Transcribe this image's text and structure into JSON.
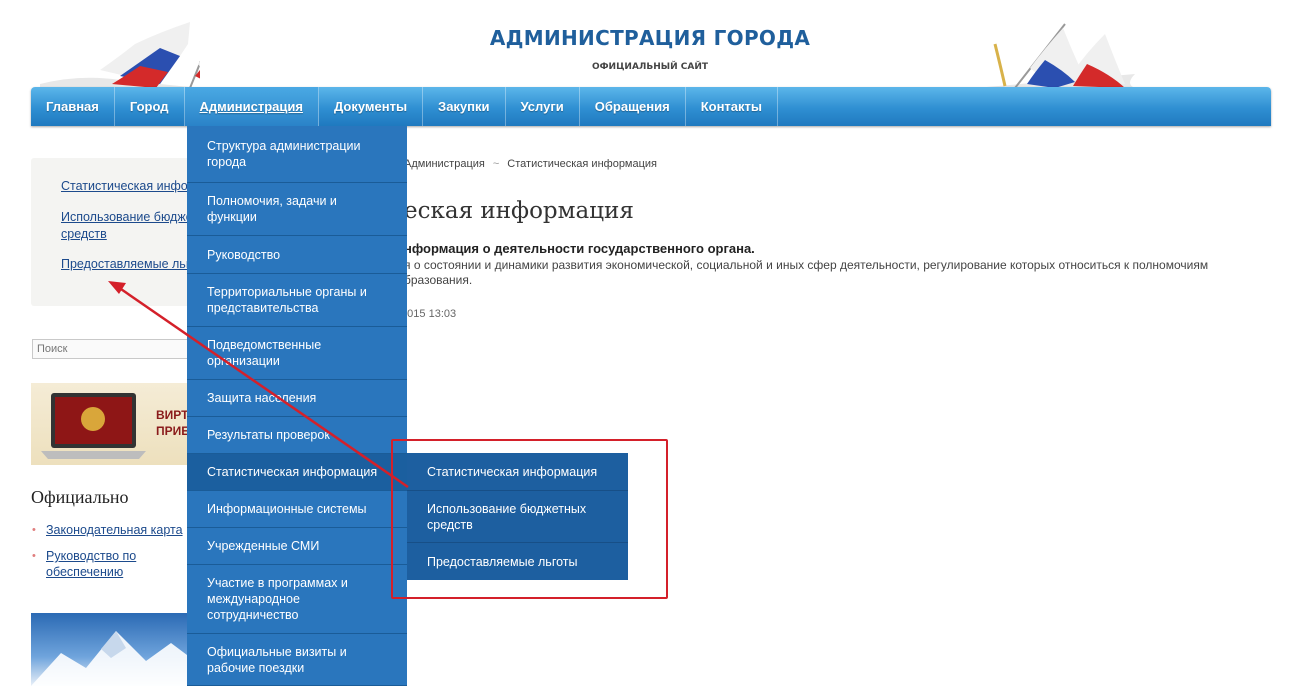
{
  "header": {
    "title": "АДМИНИСТРАЦИЯ ГОРОДА",
    "subtitle": "ОФИЦИАЛЬНЫЙ САЙТ"
  },
  "nav": {
    "items": [
      {
        "label": "Главная"
      },
      {
        "label": "Город"
      },
      {
        "label": "Администрация"
      },
      {
        "label": "Документы"
      },
      {
        "label": "Закупки"
      },
      {
        "label": "Услуги"
      },
      {
        "label": "Обращения"
      },
      {
        "label": "Контакты"
      }
    ]
  },
  "sidebar": {
    "links": [
      {
        "label": "Статистическая информация"
      },
      {
        "label": "Использование бюджетных"
      },
      {
        "label": "средств"
      },
      {
        "label": "Предоставляемые льготы"
      }
    ],
    "search_placeholder": "Поиск",
    "banner_line1": "ВИРТ",
    "banner_line2": "ПРИЕ",
    "official_title": "Официально",
    "official_links": [
      {
        "label": "Законодательная карта"
      },
      {
        "label": "Руководство по обеспечению доступности веб-контента"
      }
    ]
  },
  "main": {
    "breadcrumb_current_parent": "Администрация",
    "breadcrumb_sep": "~",
    "breadcrumb_current": "Статистическая информация",
    "title": "еская информация",
    "subheading": "нформация о деятельности государственного органа.",
    "description": "я о состоянии и динамики развития экономической, социальной и иных сфер деятельности, регулирование которых относиться к полномочиям",
    "description2": "бразования.",
    "date": ".2015 13:03"
  },
  "dropdown": {
    "items": [
      {
        "label": "Структура администрации города"
      },
      {
        "label": "Полномочия, задачи и функции"
      },
      {
        "label": "Руководство"
      },
      {
        "label": "Территориальные органы и представительства"
      },
      {
        "label": "Подведомственные организации"
      },
      {
        "label": "Защита населения"
      },
      {
        "label": "Результаты проверок"
      },
      {
        "label": "Статистическая информация"
      },
      {
        "label": "Информационные системы"
      },
      {
        "label": "Учрежденные СМИ"
      },
      {
        "label": "Участие в программах и международное сотрудничество"
      },
      {
        "label": "Официальные визиты и рабочие поездки"
      }
    ]
  },
  "submenu": {
    "items": [
      {
        "label": "Статистическая информация"
      },
      {
        "label": "Использование бюджетных средств"
      },
      {
        "label": "Предоставляемые льготы"
      }
    ]
  },
  "colors": {
    "nav_blue": "#2f8fd2",
    "dropdown_blue": "#2a76bd",
    "submenu_blue": "#1d5fa0",
    "title_blue": "#1f5f9c",
    "highlight_red": "#d4202a"
  }
}
